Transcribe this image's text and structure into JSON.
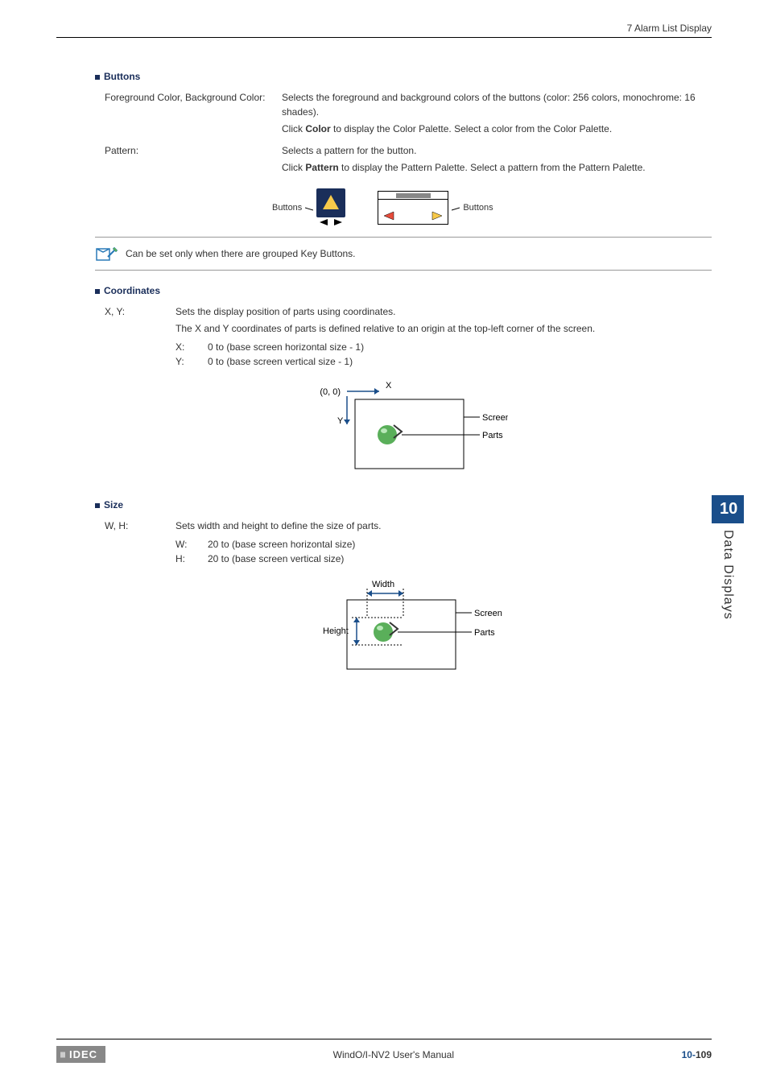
{
  "header": {
    "section_title": "7 Alarm List Display"
  },
  "buttons_section": {
    "heading": "Buttons",
    "fg_bg_term": "Foreground Color, Background Color:",
    "fg_bg_line1": "Selects the foreground and background colors of the buttons (color: 256 colors, monochrome: 16 shades).",
    "fg_bg_line2a": "Click ",
    "fg_bg_line2_bold": "Color",
    "fg_bg_line2b": " to display the Color Palette. Select a color from the Color Palette.",
    "pattern_term": "Pattern:",
    "pattern_line1": "Selects a pattern for the button.",
    "pattern_line2a": "Click ",
    "pattern_line2_bold": "Pattern",
    "pattern_line2b": " to display the Pattern Palette. Select a pattern from the Pattern Palette.",
    "illo_label_left": "Buttons",
    "illo_label_right": "Buttons",
    "note_text": "Can be set only when there are grouped Key Buttons."
  },
  "coordinates_section": {
    "heading": "Coordinates",
    "xy_term": "X, Y:",
    "xy_line1": "Sets the display position of parts using coordinates.",
    "xy_line2": "The X and Y coordinates of parts is defined relative to an origin at the top-left corner of the screen.",
    "x_label": "X:",
    "x_range": "0 to (base screen horizontal size - 1)",
    "y_label": "Y:",
    "y_range": "0 to (base screen vertical size - 1)",
    "diag_origin": "(0, 0)",
    "diag_x": "X",
    "diag_y": "Y",
    "diag_screen": "Screen",
    "diag_parts": "Parts"
  },
  "size_section": {
    "heading": "Size",
    "wh_term": "W, H:",
    "wh_line1": "Sets width and height to define the size of parts.",
    "w_label": "W:",
    "w_range": "20 to (base screen horizontal size)",
    "h_label": "H:",
    "h_range": "20 to (base screen vertical size)",
    "diag_width": "Width",
    "diag_height": "Height",
    "diag_screen": "Screen",
    "diag_parts": "Parts"
  },
  "side_tab": {
    "number": "10",
    "label": "Data Displays"
  },
  "footer": {
    "logo": "IDEC",
    "title": "WindO/I-NV2 User's Manual",
    "page_prefix": "10-",
    "page_num": "109"
  }
}
